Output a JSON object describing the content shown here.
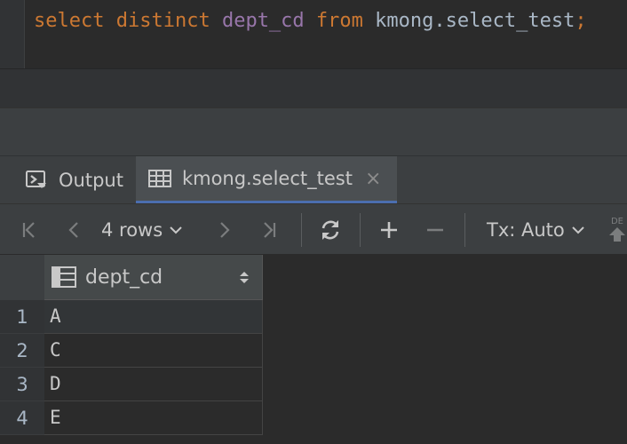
{
  "editor": {
    "sql": {
      "kw_select": "select",
      "kw_distinct": "distinct",
      "column": "dept_cd",
      "kw_from": "from",
      "table": "kmong.select_test",
      "terminator": ";"
    }
  },
  "tabs": [
    {
      "label": "Output",
      "icon": "console-output-icon"
    },
    {
      "label": "kmong.select_test",
      "icon": "table-grid-icon",
      "close": "×"
    }
  ],
  "toolbar": {
    "row_count": "4 rows",
    "tx_mode": "Tx: Auto",
    "clipped_label": "DE"
  },
  "grid": {
    "column": "dept_cd",
    "rows": [
      {
        "num": "1",
        "value": "A"
      },
      {
        "num": "2",
        "value": "C"
      },
      {
        "num": "3",
        "value": "D"
      },
      {
        "num": "4",
        "value": "E"
      }
    ]
  },
  "colors": {
    "keyword": "#cc7832",
    "identifier": "#9876aa",
    "text": "#a9b7c6",
    "active_tab_underline": "#4b6eaf"
  }
}
